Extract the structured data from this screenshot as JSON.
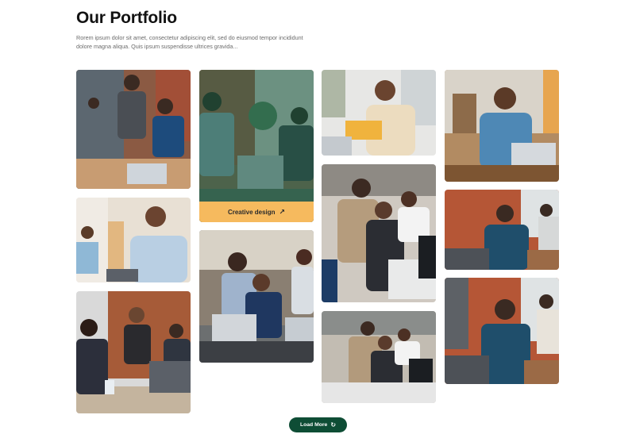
{
  "header": {
    "title": "Our Portfolio",
    "description": "Rorem ipsum dolor sit amet, consectetur adipiscing elit, sed do eiusmod tempor incididunt dolore magna aliqua. Quis ipsum suspendisse ultrices gravida..."
  },
  "gallery": {
    "featured_caption": "Creative design",
    "featured_icon": "arrow-up-right-icon",
    "overlay_color": "#185c46",
    "caption_color": "#f6ba5e"
  },
  "actions": {
    "load_more_label": "Load More",
    "load_more_icon": "refresh-icon",
    "button_color": "#0e4d35"
  }
}
